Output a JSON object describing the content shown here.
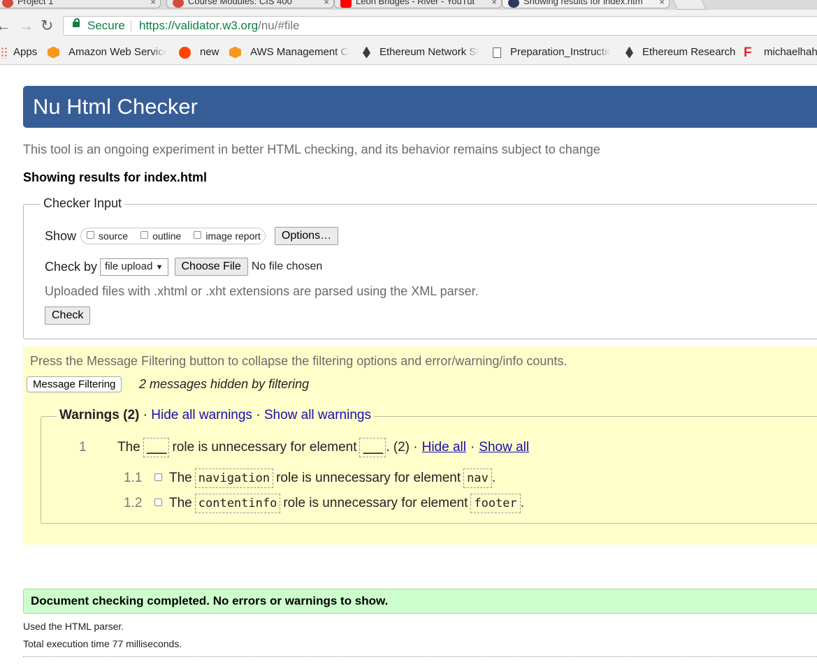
{
  "browser": {
    "tabs": [
      {
        "title": "Project 1",
        "close": "×"
      },
      {
        "title": "Course Modules: CIS 400",
        "close": "×"
      },
      {
        "title": "Leon Bridges - River - YouTube",
        "close": "×"
      },
      {
        "title": "Showing results for index.html",
        "close": "×"
      }
    ],
    "nav": {
      "back": "←",
      "forward": "→",
      "reload": "↻"
    },
    "address": {
      "secure_label": "Secure",
      "url_scheme": "https://validator.w3.org",
      "url_rest": "/nu/#file"
    },
    "bookmarks": [
      {
        "label": "Apps",
        "icon": "apps-grid-icon"
      },
      {
        "label": "Amazon Web Services",
        "icon": "aws-cube-icon"
      },
      {
        "label": "new",
        "icon": "reddit-icon"
      },
      {
        "label": "AWS Management Console",
        "icon": "aws-cube-icon"
      },
      {
        "label": "Ethereum Network Status",
        "icon": "ethereum-icon"
      },
      {
        "label": "Preparation_Instructions",
        "icon": "document-icon"
      },
      {
        "label": "Ethereum Research",
        "icon": "ethereum-icon"
      },
      {
        "label": "michaelhah",
        "icon": "f-logo-icon"
      }
    ]
  },
  "page": {
    "title": "Nu Html Checker",
    "intro": "This tool is an ongoing experiment in better HTML checking, and its behavior remains subject to change",
    "results_heading": "Showing results for index.html"
  },
  "checker_input": {
    "legend": "Checker Input",
    "show_label": "Show",
    "show_options": [
      "source",
      "outline",
      "image report"
    ],
    "options_button": "Options…",
    "check_by_label": "Check by",
    "check_by_value": "file upload",
    "choose_file_button": "Choose File",
    "no_file": "No file chosen",
    "note": "Uploaded files with .xhtml or .xht extensions are parsed using the XML parser.",
    "check_button": "Check"
  },
  "filtering": {
    "instruction": "Press the Message Filtering button to collapse the filtering options and error/warning/info counts.",
    "button": "Message Filtering",
    "hidden_note": "2 messages hidden by filtering",
    "warnings_title": "Warnings (2)",
    "hide_all_warnings": "Hide all warnings",
    "show_all_warnings": "Show all warnings",
    "group": {
      "num": "1",
      "pre": "The",
      "blank1": "___",
      "mid": "role is unnecessary for element",
      "blank2": "___",
      "count": ". (2) ·",
      "hide_all": "Hide all",
      "dot": "·",
      "show_all": "Show all"
    },
    "messages": [
      {
        "num": "1.1",
        "pre": "The",
        "role": "navigation",
        "mid": "role is unnecessary for element",
        "element": "nav",
        "end": "."
      },
      {
        "num": "1.2",
        "pre": "The",
        "role": "contentinfo",
        "mid": "role is unnecessary for element",
        "element": "footer",
        "end": "."
      }
    ]
  },
  "result": {
    "completed": "Document checking completed. No errors or warnings to show.",
    "parser": "Used the HTML parser.",
    "time": "Total execution time 77 milliseconds."
  },
  "colors": {
    "banner": "#365d95",
    "filter_bg": "#ffffcc",
    "success_bg": "#ccffcc",
    "secure_green": "#0b8043",
    "link": "#1a0dab"
  }
}
